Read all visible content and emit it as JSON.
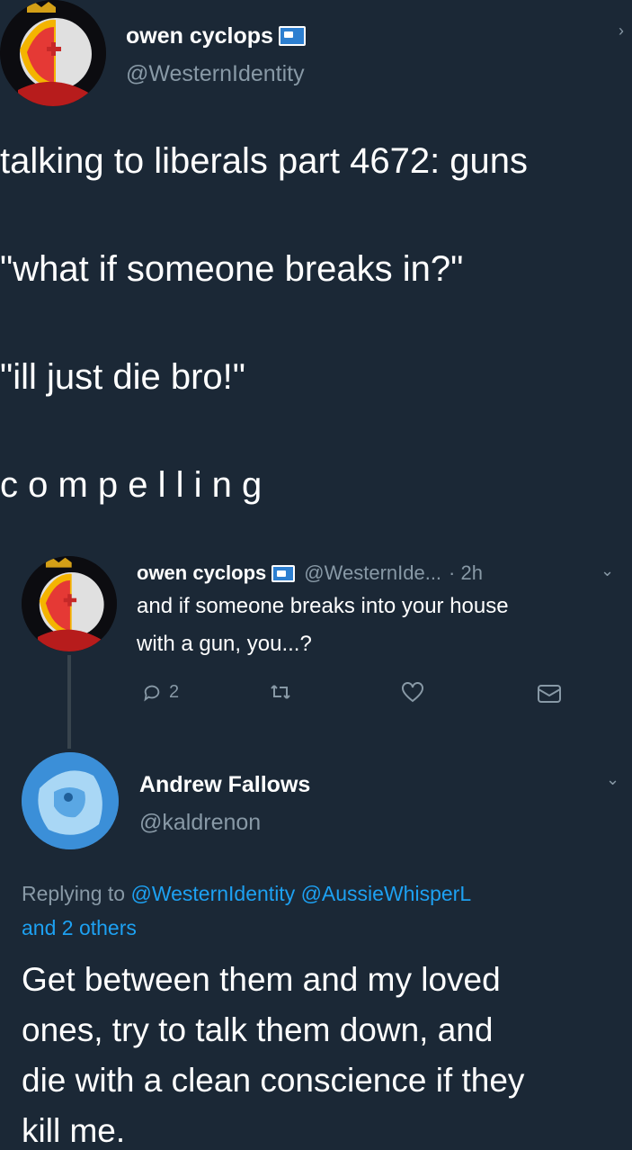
{
  "main_tweet": {
    "name": "owen cyclops",
    "handle": "@WesternIdentity",
    "lines": [
      "talking to liberals part 4672: guns",
      "\"what if someone breaks in?\"",
      "\"ill just die bro!\"",
      "c o m p e l l i n g"
    ]
  },
  "quoted_tweet": {
    "name": "owen cyclops",
    "handle": "@WesternIde...",
    "time": "· 2h",
    "line1": "and if someone breaks into your house",
    "line2": "with a gun, you...?",
    "reply_count": "2"
  },
  "reply": {
    "name": "Andrew Fallows",
    "handle": "@kaldrenon",
    "replying_prefix": "Replying to",
    "replying_mentions": "@WesternIdentity @AussieWhisperL",
    "replying_others": "and 2 others",
    "lines": [
      "Get between them and my loved",
      "ones, try to talk them down, and",
      "die with a clean conscience if they",
      "kill me."
    ]
  },
  "colors": {
    "background": "#1b2836",
    "secondary_text": "#8899a6",
    "link": "#1da1f2"
  }
}
